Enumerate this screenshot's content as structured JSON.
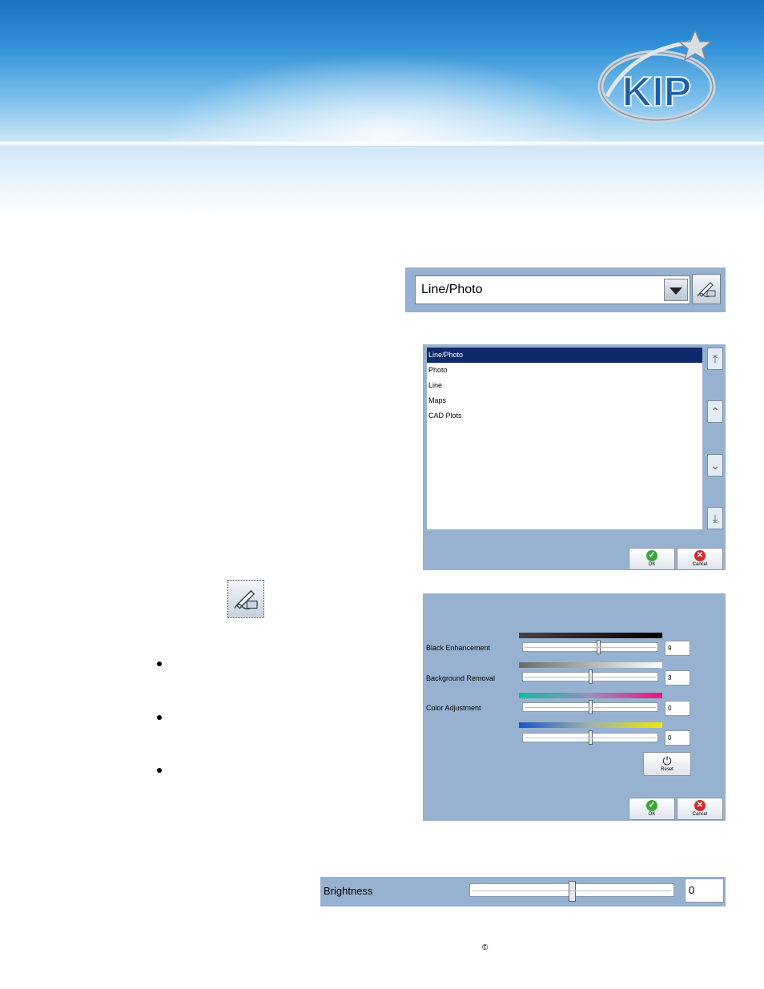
{
  "brand": {
    "logo_text": "KIP"
  },
  "mode_select": {
    "value": "Line/Photo"
  },
  "mode_list": {
    "items": [
      "Line/Photo",
      "Photo",
      "Line",
      "Maps",
      "CAD Plots"
    ],
    "selected_index": 0,
    "ok_label": "OK",
    "cancel_label": "Cancel"
  },
  "adjustments": {
    "sliders": [
      {
        "label": "Black Enhancement",
        "value": "9",
        "level": 0.56,
        "gradient": "black"
      },
      {
        "label": "Background Removal",
        "value": "3",
        "level": 0.5,
        "gradient": "gray"
      },
      {
        "label": "Color Adjustment",
        "value": "0",
        "level": 0.5,
        "gradient": "green-magenta"
      },
      {
        "label": "",
        "value": "0",
        "level": 0.5,
        "gradient": "blue-yellow"
      }
    ],
    "reset_label": "Reset",
    "ok_label": "OK",
    "cancel_label": "Cancel"
  },
  "brightness": {
    "label": "Brightness",
    "value": "0",
    "level": 0.5
  },
  "footer": {
    "copyright": "©"
  },
  "colors": {
    "panel": "#97b2d0",
    "selection": "#0e2a6b",
    "banner": "#2f8fd6"
  },
  "icons": [
    "kip-logo-icon",
    "dropdown-arrow-icon",
    "edit-settings-icon",
    "scroll-top-icon",
    "scroll-up-icon",
    "scroll-down-icon",
    "scroll-bottom-icon",
    "ok-check-icon",
    "cancel-x-icon",
    "power-reset-icon"
  ]
}
